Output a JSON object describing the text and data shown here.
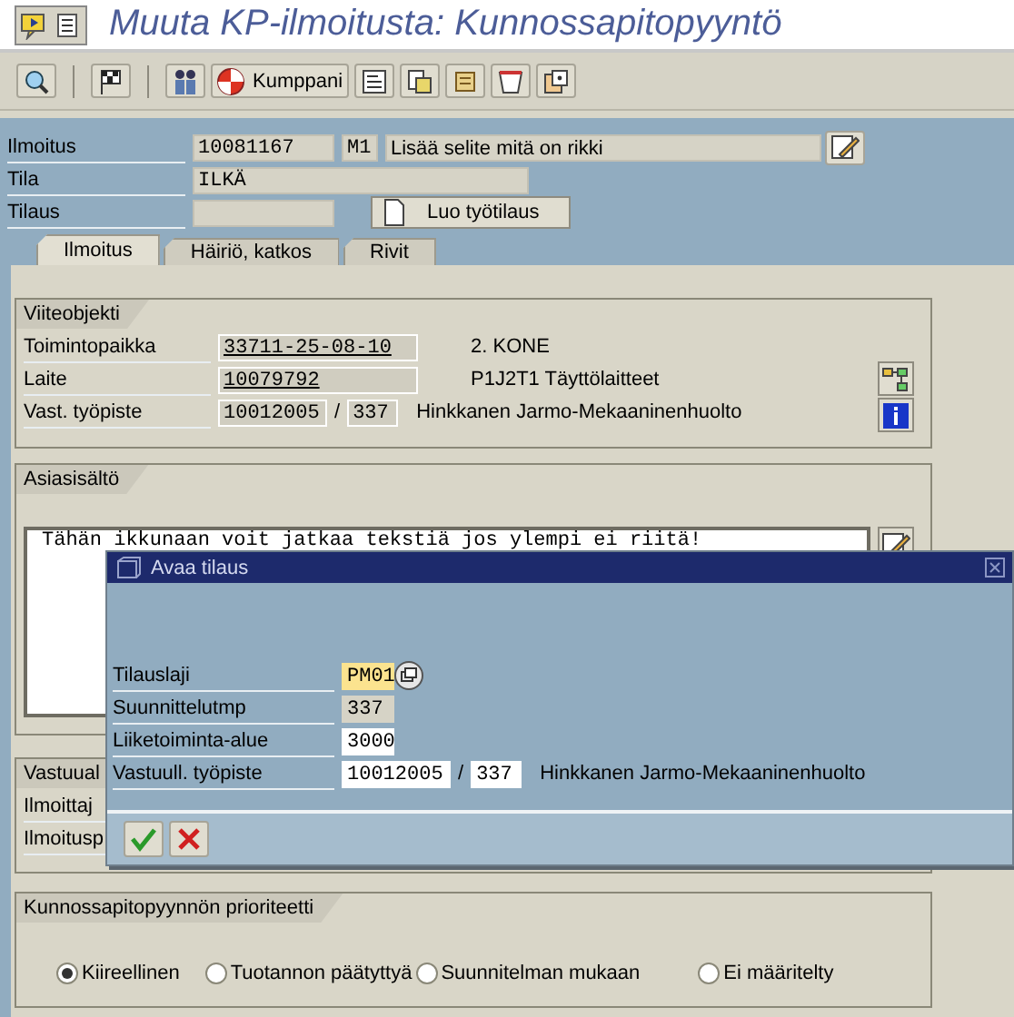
{
  "window": {
    "title": "Muuta KP-ilmoitusta: Kunnossapitopyyntö"
  },
  "toolbar": {
    "partner_button": "Kumppani"
  },
  "header": {
    "notification_label": "Ilmoitus",
    "notification_number": "10081167",
    "notification_type": "M1",
    "notification_text": "Lisää selite mitä on rikki",
    "status_label": "Tila",
    "status_value": "ILKÄ",
    "order_label": "Tilaus",
    "create_order_button": "Luo työtilaus"
  },
  "tabs": [
    {
      "label": "Ilmoitus",
      "selected": true
    },
    {
      "label": "Häiriö, katkos",
      "selected": false
    },
    {
      "label": "Rivit",
      "selected": false
    }
  ],
  "reference_object": {
    "title": "Viiteobjekti",
    "rows": [
      {
        "label": "Toimintopaikka",
        "value": "33711-25-08-10",
        "linked": true,
        "description": "2. KONE"
      },
      {
        "label": "Laite",
        "value": "10079792",
        "linked": true,
        "description": "P1J2T1 Täyttölaitteet"
      }
    ],
    "work_center": {
      "label": "Vast. työpiste",
      "value": "10012005",
      "separator": "/",
      "plant": "337",
      "description": "Hinkkanen Jarmo-Mekaaninenhuolto"
    }
  },
  "subject": {
    "title": "Asiasisältö",
    "text": "Tähän ikkunaan voit jatkaa tekstiä jos ylempi ei riitä!"
  },
  "responsibility": {
    "title": "Vastuual",
    "rows": [
      "Ilmoittaj",
      "Ilmoitusp"
    ]
  },
  "priority": {
    "title": "Kunnossapitopyynnön prioriteetti",
    "options": [
      {
        "label": "Kiireellinen",
        "selected": true
      },
      {
        "label": "Tuotannon päätyttyä",
        "selected": false
      },
      {
        "label": "Suunnitelman mukaan",
        "selected": false
      },
      {
        "label": "Ei määritelty",
        "selected": false
      }
    ]
  },
  "dialog": {
    "title": "Avaa tilaus",
    "fields": [
      {
        "label": "Tilauslaji",
        "value": "PM01",
        "kind": "required"
      },
      {
        "label": "Suunnittelutmp",
        "value": "337",
        "kind": "readonly"
      },
      {
        "label": "Liiketoiminta-alue",
        "value": "3000",
        "kind": "input"
      }
    ],
    "work_center": {
      "label": "Vastuull. työpiste",
      "value": "10012005",
      "separator": "/",
      "plant": "337",
      "description": "Hinkkanen Jarmo-Mekaaninenhuolto"
    }
  }
}
